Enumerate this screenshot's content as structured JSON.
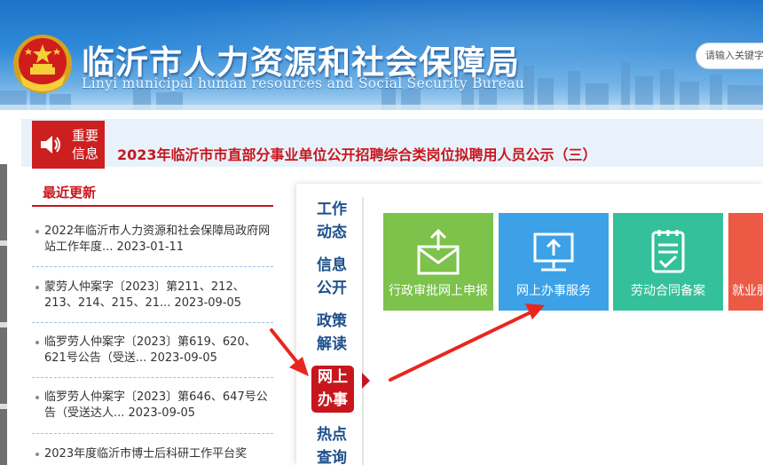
{
  "header": {
    "title": "临沂市人力资源和社会保障局",
    "subtitle": "Linyi municipal human resources and Social Security Bureau",
    "search_placeholder": "请输入关键字"
  },
  "notice": {
    "badge_line1": "重要",
    "badge_line2": "信息",
    "headline": "2023年临沂市市直部分事业单位公开招聘综合类岗位拟聘用人员公示（三）"
  },
  "recent": {
    "title": "最近更新",
    "items": [
      {
        "text": "2022年临沂市人力资源和社会保障局政府网站工作年度... 2023-01-11"
      },
      {
        "text": "蒙劳人仲案字〔2023〕第211、212、213、214、215、21... 2023-09-05"
      },
      {
        "text": "临罗劳人仲案字〔2023〕第619、620、621号公告（受送... 2023-09-05"
      },
      {
        "text": "临罗劳人仲案字〔2023〕第646、647号公告（受送达人... 2023-09-05"
      },
      {
        "text": "2023年度临沂市博士后科研工作平台奖"
      }
    ]
  },
  "panel": {
    "tabs": [
      {
        "l1": "工作",
        "l2": "动态"
      },
      {
        "l1": "信息",
        "l2": "公开"
      },
      {
        "l1": "政策",
        "l2": "解读"
      },
      {
        "l1": "网上",
        "l2": "办事"
      },
      {
        "l1": "热点",
        "l2": "查询"
      }
    ],
    "active_tab_index": 3,
    "tiles": [
      {
        "label": "行政审批网上申报",
        "color": "#7cc24b",
        "icon": "envelope-upload-icon"
      },
      {
        "label": "网上办事服务",
        "color": "#3ca1e6",
        "icon": "monitor-upload-icon"
      },
      {
        "label": "劳动合同备案",
        "color": "#34c09a",
        "icon": "clipboard-check-icon"
      },
      {
        "label": "就业服务",
        "color": "#ec5a45",
        "icon": "employment-icon"
      }
    ]
  },
  "colors": {
    "accent_red": "#c8161d",
    "nav_blue": "#1d4f8c",
    "annotation_arrow": "#e8261f"
  }
}
